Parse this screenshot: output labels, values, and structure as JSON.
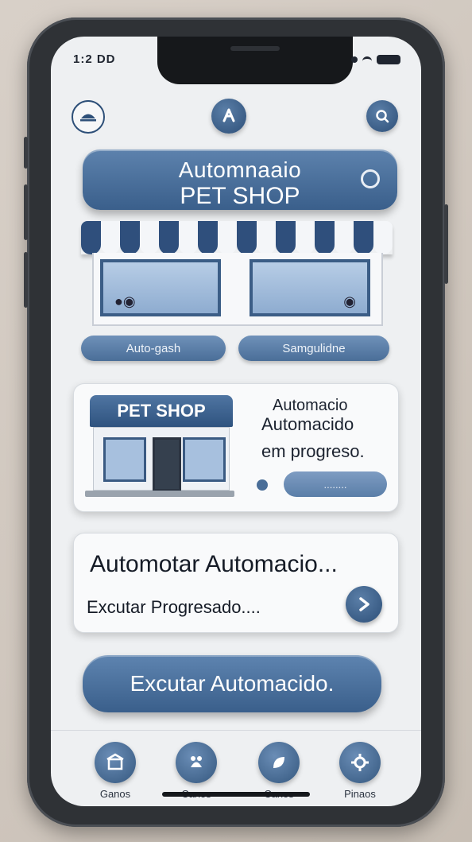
{
  "status": {
    "time": "1:2 DD"
  },
  "header": {
    "title_line1": "Automnaaio",
    "title_line2": "PET SHOP"
  },
  "chips": {
    "left": "Auto-gash",
    "right": "Samgulidne"
  },
  "card_status": {
    "sign": "PET SHOP",
    "line1": "Automacio",
    "line2": "Automacido",
    "line3": "em progreso.",
    "progress_label": "........"
  },
  "card_run": {
    "line1": "Automotar Automacio...",
    "line2": "Excutar Progresado...."
  },
  "cta": {
    "label": "Excutar Automacido."
  },
  "tabs": [
    {
      "label": "Ganos"
    },
    {
      "label": "Canos"
    },
    {
      "label": "Canos"
    },
    {
      "label": "Pinaos"
    }
  ],
  "colors": {
    "accent": "#3a5f8b",
    "awning_blue": "#2f4f7c",
    "awning_white": "#f4f6f9",
    "screen_bg": "#eef0f2"
  }
}
